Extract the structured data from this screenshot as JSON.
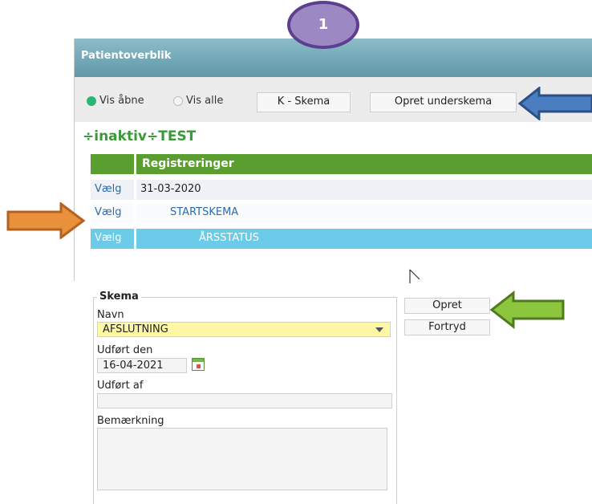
{
  "window": {
    "title": "Patientoverblik"
  },
  "annotation": {
    "badge_number": "1"
  },
  "toolbar": {
    "radio_open_label": "Vis åbne",
    "radio_all_label": "Vis alle",
    "k_schema_button": "K - Skema",
    "create_subschema_button": "Opret underskema"
  },
  "tree": {
    "title": "÷inaktiv÷TEST",
    "header": "Registreringer",
    "rows": [
      {
        "action": "Vælg",
        "text": "31-03-2020"
      },
      {
        "action": "Vælg",
        "text": "STARTSKEMA"
      },
      {
        "action": "Vælg",
        "text": "ÅRSSTATUS"
      }
    ]
  },
  "form": {
    "legend": "Skema",
    "name_label": "Navn",
    "name_value": "AFSLUTNING",
    "done_date_label": "Udført den",
    "done_date_value": "16-04-2021",
    "done_by_label": "Udført af",
    "done_by_value": "",
    "remark_label": "Bemærkning",
    "remark_value": "",
    "create_button": "Opret",
    "cancel_button": "Fortryd"
  },
  "colors": {
    "title_bar": "#6aa3b3",
    "tree_header": "#5a9e2f",
    "selected_row": "#6ccbe8",
    "highlight_field": "#fdf7a6",
    "arrow_blue": "#4a7ec0",
    "arrow_orange": "#e8913a",
    "arrow_green": "#8cc63f",
    "badge_fill": "#9c89c4"
  }
}
